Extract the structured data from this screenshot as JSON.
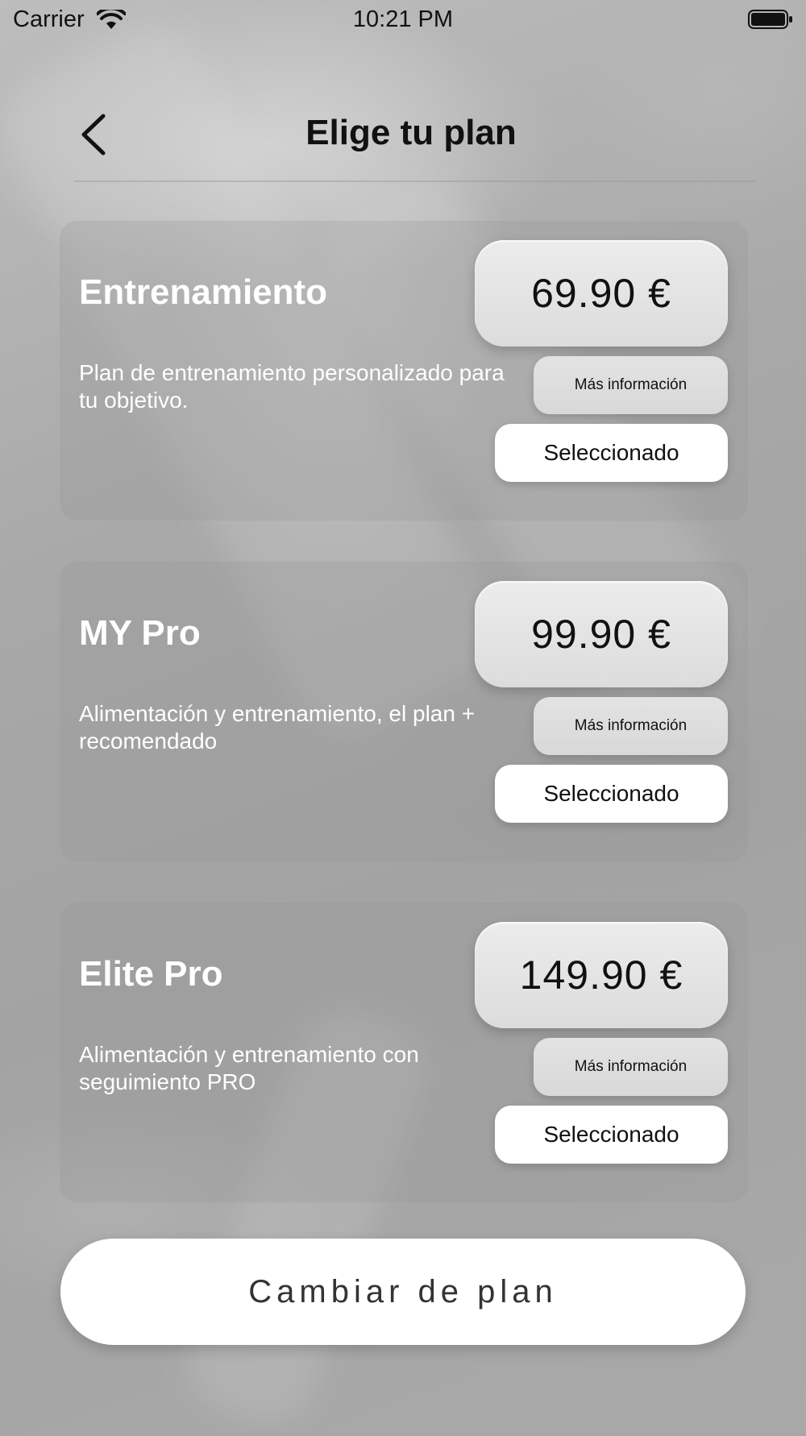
{
  "status_bar": {
    "carrier": "Carrier",
    "time": "10:21 PM"
  },
  "header": {
    "title": "Elige tu plan",
    "back_icon": "chevron-left-icon"
  },
  "plans": [
    {
      "name": "Entrenamiento",
      "price": "69.90 €",
      "description": "Plan de entrenamiento personalizado para tu objetivo.",
      "info_label": "Más información",
      "select_label": "Seleccionado"
    },
    {
      "name": "MY Pro",
      "price": "99.90 €",
      "description": "Alimentación y entrenamiento, el plan + recomendado",
      "info_label": "Más información",
      "select_label": "Seleccionado"
    },
    {
      "name": "Elite Pro",
      "price": "149.90 €",
      "description": "Alimentación y entrenamiento con seguimiento PRO",
      "info_label": "Más información",
      "select_label": "Seleccionado"
    }
  ],
  "footer": {
    "change_plan_label": "Cambiar de plan"
  },
  "colors": {
    "background": "#a6a6a6",
    "card": "rgba(150,150,150,0.28)",
    "button_white": "#ffffff",
    "price_box": "#e4e4e4",
    "text_dark": "#111111",
    "text_light": "#ffffff"
  }
}
